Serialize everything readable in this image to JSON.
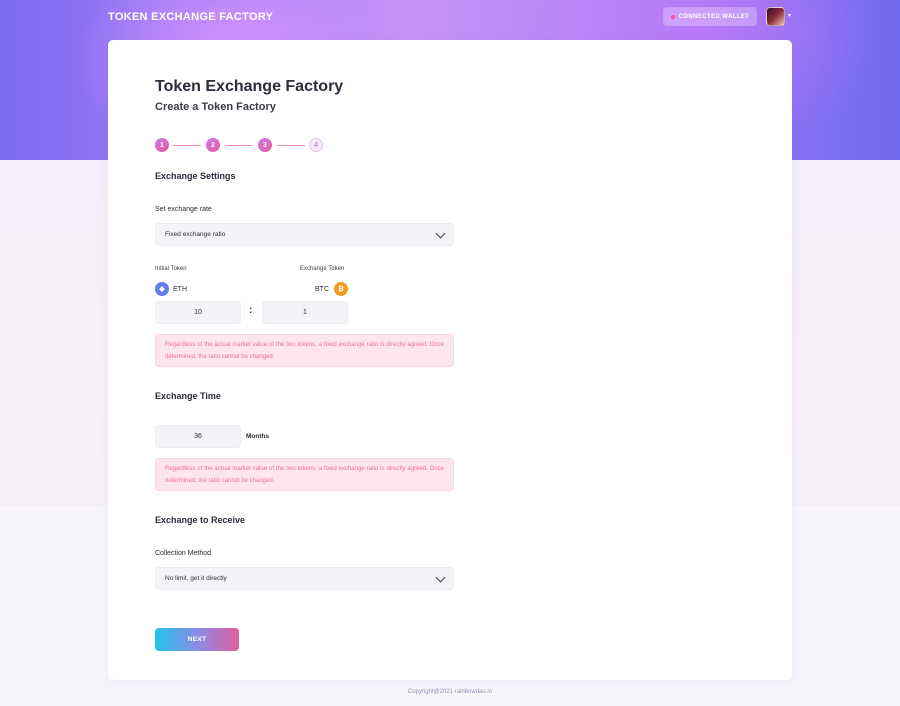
{
  "header": {
    "brand": "TOKEN EXCHANGE FACTORY",
    "wallet_button": "CONNECTED WALLET"
  },
  "page": {
    "title": "Token Exchange Factory",
    "subtitle": "Create a Token Factory"
  },
  "steps": [
    "1",
    "2",
    "3",
    "4"
  ],
  "exchange_settings": {
    "heading": "Exchange Settings",
    "rate_label": "Set exchange rate",
    "rate_selected": "Fixed exchange ratio",
    "initial_token_label": "Initial Token",
    "exchange_token_label": "Exchange Token",
    "initial_token": "ETH",
    "exchange_token": "BTC",
    "initial_amount": "10",
    "exchange_amount": "1",
    "ratio_separator": ":",
    "notice": "Regardless of the actual market value of the two tokens, a fixed exchange ratio is directly agreed. Once determined, the ratio cannot be changed."
  },
  "exchange_time": {
    "heading": "Exchange Time",
    "value": "36",
    "unit": "Months",
    "notice": "Regardless of the actual market value of the two tokens, a fixed exchange ratio is directly agreed. Once determined, the ratio cannot be changed."
  },
  "exchange_receive": {
    "heading": "Exchange to Receive",
    "method_label": "Collection Method",
    "method_selected": "No limit, get it directly"
  },
  "next_button": "NEXT",
  "footer": "Copyright@2021 rainbowdao.io",
  "colors": {
    "accent_pink": "#e75a9f",
    "accent_cyan": "#23c3e8",
    "notice_bg": "#ffe5ee",
    "notice_text": "#ef6f98"
  }
}
